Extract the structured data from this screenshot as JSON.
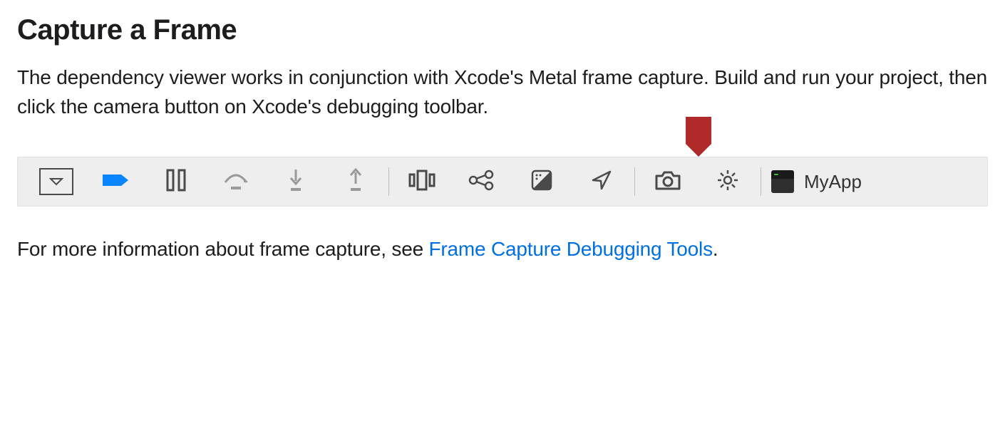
{
  "heading": "Capture a Frame",
  "paragraph1": "The dependency viewer works in conjunction with Xcode's Metal frame capture. Build and run your project, then click the camera button on Xcode's debugging toolbar.",
  "footer_prefix": "For more information about frame capture, see ",
  "footer_link_text": "Frame Capture Debugging Tools",
  "footer_suffix": ".",
  "toolbar": {
    "app_name": "MyApp",
    "icons": [
      "debug-dropdown-icon",
      "breakpoint-icon",
      "pause-icon",
      "step-over-icon",
      "step-into-icon",
      "step-out-icon",
      "view-debugger-icon",
      "memory-graph-icon",
      "environment-overrides-icon",
      "location-icon",
      "camera-icon",
      "settings-gear-icon"
    ]
  }
}
